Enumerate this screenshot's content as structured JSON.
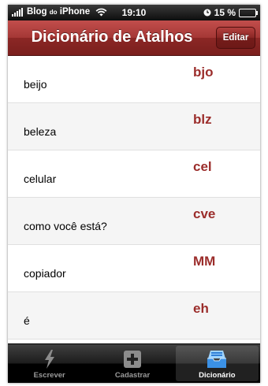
{
  "status_bar": {
    "carrier": "Blog",
    "carrier_small": "do",
    "carrier_suffix": "iPhone",
    "time": "19:10",
    "battery": "15 %",
    "battery_level": 0.15
  },
  "nav": {
    "title": "Dicionário de Atalhos",
    "edit_label": "Editar"
  },
  "entries": [
    {
      "phrase": "beijo",
      "abbr": "bjo"
    },
    {
      "phrase": "beleza",
      "abbr": "blz"
    },
    {
      "phrase": "celular",
      "abbr": "cel"
    },
    {
      "phrase": "como você está?",
      "abbr": "cve"
    },
    {
      "phrase": "copiador",
      "abbr": "MM"
    },
    {
      "phrase": "é",
      "abbr": "eh"
    }
  ],
  "tabs": [
    {
      "label": "Escrever",
      "icon": "lightning-icon"
    },
    {
      "label": "Cadastrar",
      "icon": "add-icon"
    },
    {
      "label": "Dicionário",
      "icon": "inbox-tray-icon"
    }
  ],
  "colors": {
    "accent": "#9b2d2b",
    "nav_bar": "#a43735"
  }
}
